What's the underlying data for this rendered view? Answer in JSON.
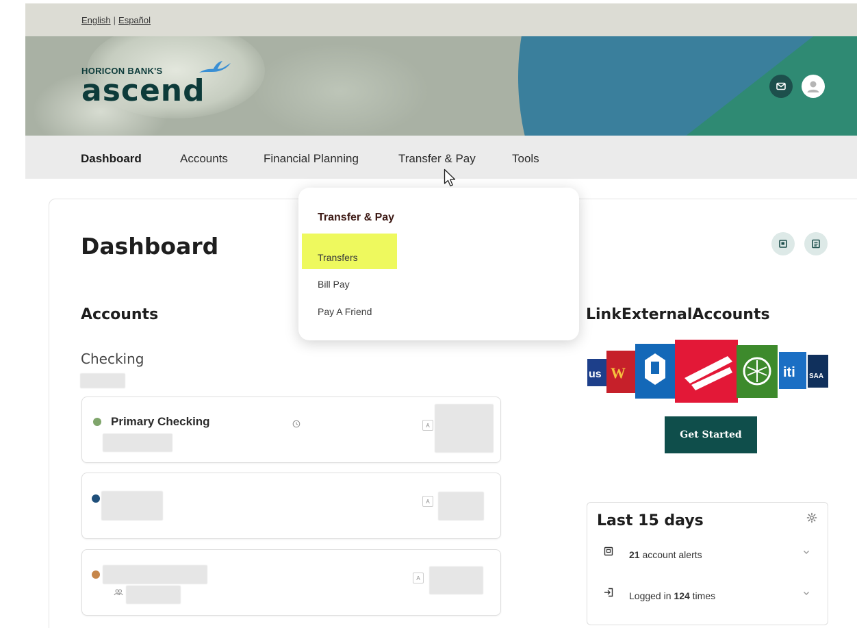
{
  "lang": {
    "english": "English",
    "separator": "|",
    "spanish": "Español"
  },
  "brand": {
    "name_small": "HORICON BANK'S",
    "name_big": "ascend"
  },
  "nav": {
    "items": [
      {
        "label": "Dashboard"
      },
      {
        "label": "Accounts"
      },
      {
        "label": "Financial Planning"
      },
      {
        "label": "Transfer & Pay"
      },
      {
        "label": "Tools"
      }
    ]
  },
  "dropdown": {
    "title": "Transfer & Pay",
    "items": [
      {
        "label": "Transfers"
      },
      {
        "label": "Bill Pay"
      },
      {
        "label": "Pay A Friend"
      }
    ]
  },
  "page": {
    "title": "Dashboard"
  },
  "accounts": {
    "title": "Accounts",
    "group_label": "Checking",
    "cards": [
      {
        "name": "Primary Checking",
        "dot_color": "#7fa56b",
        "badge": "A"
      },
      {
        "name": "",
        "dot_color": "#1f4f7a",
        "badge": "A"
      },
      {
        "name": "",
        "dot_color": "#c6864a",
        "badge": "A"
      }
    ]
  },
  "link_external": {
    "title": "LinkExternalAccounts",
    "button": "Get Started"
  },
  "last15": {
    "title": "Last 15 days",
    "rows": [
      {
        "count": "21",
        "label": "account alerts"
      },
      {
        "prefix": "Logged in",
        "count": "124",
        "label": "times"
      }
    ]
  },
  "colors": {
    "brand_teal": "#0f4e4b",
    "highlight": "#eef95e",
    "nav_bg": "#ebebeb",
    "topbar_bg": "#dcdcd4"
  }
}
